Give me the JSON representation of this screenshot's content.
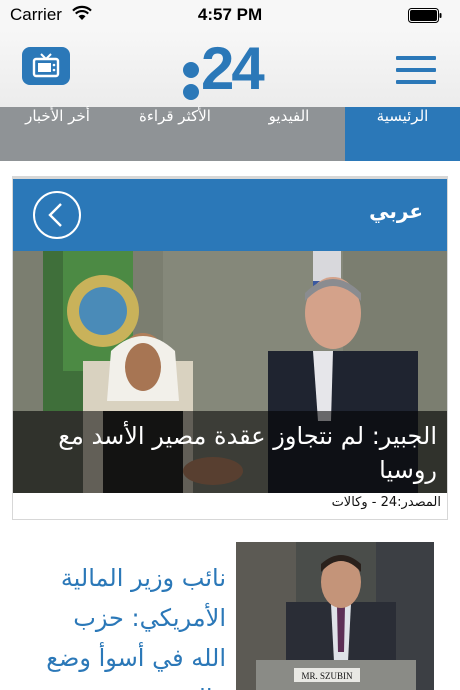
{
  "status_bar": {
    "carrier": "Carrier",
    "time": "4:57 PM",
    "icons": [
      "wifi-icon",
      "battery-icon"
    ]
  },
  "header": {
    "logo_text": "24",
    "left_icon": "tv-icon",
    "right_icon": "hamburger-menu-icon"
  },
  "nav": {
    "tabs": [
      {
        "label": "الرئيسية",
        "active": true
      },
      {
        "label": "الفيديو",
        "active": false
      },
      {
        "label": "الأكثر قراءة",
        "active": false
      },
      {
        "label": "أخر الأخبار",
        "active": false
      }
    ]
  },
  "section": {
    "label": "عربي",
    "back_icon": "chevron-left-icon"
  },
  "featured": {
    "headline": "الجبير: لم نتجاوز عقدة مصير الأسد مع روسيا",
    "source": "المصدر:24 - وكالات"
  },
  "second_article": {
    "headline": "نائب وزير المالية الأمريكي: حزب الله في أسوأ وضع مالي منذ",
    "nameplate": "MR. SZUBIN"
  },
  "colors": {
    "accent": "#2b78b8",
    "nav_bg": "#8f9396",
    "header_bg": "#f2f2f2"
  }
}
